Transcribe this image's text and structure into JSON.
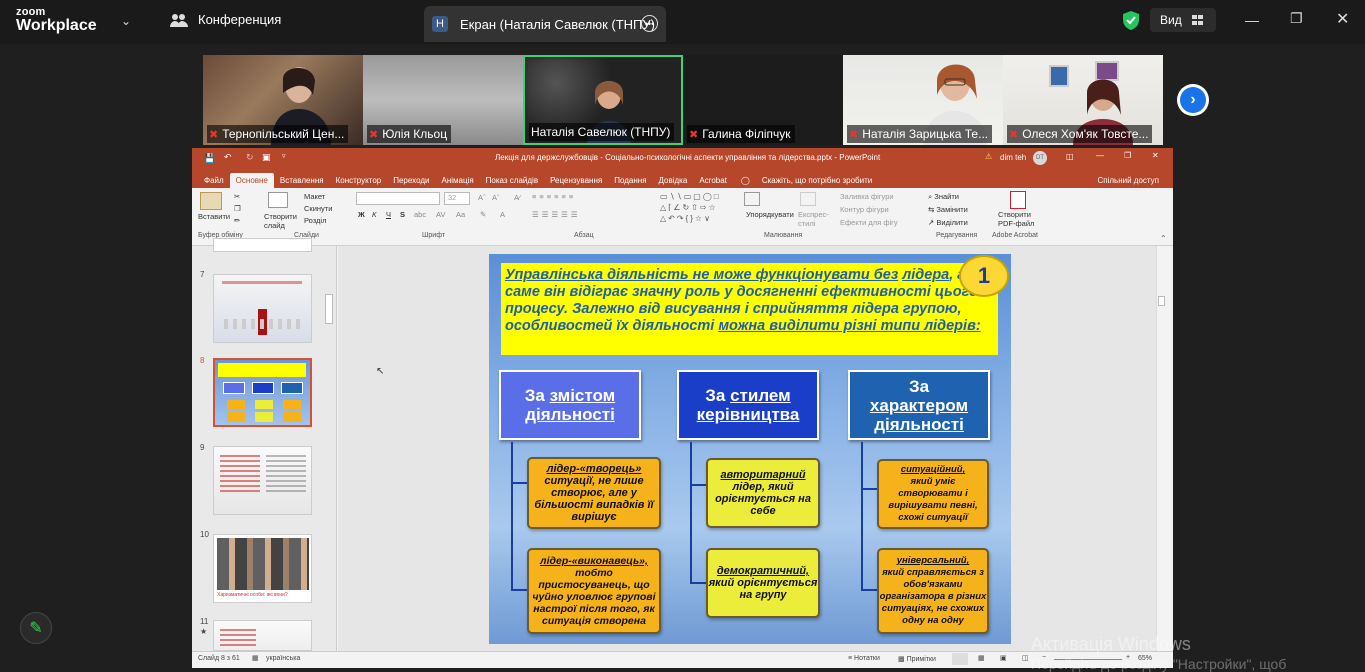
{
  "zoom": {
    "logo_top": "zoom",
    "logo_bottom": "Workplace",
    "conference_label": "Конференция",
    "share_tab_letter": "Н",
    "share_tab_label": "Екран (Наталія Савелюк (ТНПУ)",
    "view_label": "Вид",
    "participants": [
      {
        "name": "Тернопільський Цен...",
        "muted": true
      },
      {
        "name": "Юлія Кльоц",
        "muted": true
      },
      {
        "name": "Наталія Савелюк (ТНПУ)",
        "muted": false,
        "active_speaker": true
      },
      {
        "name": "Галина Філіпчук",
        "muted": true
      },
      {
        "name": "Наталія Зарицька Те...",
        "muted": true
      },
      {
        "name": "Олеся Хом'як Товсте...",
        "muted": true
      }
    ],
    "accent_color": "#1a73e8",
    "shield_color": "#22c55e"
  },
  "ppt": {
    "title": "Лекція для держслужбовців - Соціально-психологічні аспекти управління та лідерства.pptx - PowerPoint",
    "user": "dim teh",
    "user_initials": "DT",
    "warning": "⚠",
    "tabs": [
      "Файл",
      "Основне",
      "Вставлення",
      "Конструктор",
      "Переходи",
      "Анімація",
      "Показ слайдів",
      "Рецензування",
      "Подання",
      "Довідка",
      "Acrobat"
    ],
    "tell_me": "Скажіть, що потрібно зробити",
    "share": "Спільний доступ",
    "ribbon": {
      "paste": "Вставити",
      "clipboard": "Буфер обміну",
      "new_slide": "Створити слайд",
      "layout": "Макет",
      "reset": "Скинути",
      "section": "Розділ",
      "slides": "Слайди",
      "font": "Шрифт",
      "paragraph": "Абзац",
      "arrange": "Упорядкувати",
      "quick_styles": "Експрес-стилі",
      "shape_fill": "Заливка фігури",
      "shape_outline": "Контур фігури",
      "shape_effects": "Ефекти для фігу",
      "drawing": "Малювання",
      "find": "Знайти",
      "replace": "Замінити",
      "select": "Виділити",
      "editing": "Редагування",
      "create_pdf": "Створити PDF-файл",
      "adobe": "Adobe Acrobat",
      "font_size": "32",
      "bold": "Ж",
      "italic": "К",
      "underline": "Ч",
      "strike": "S"
    },
    "thumb_numbers": [
      "7",
      "8",
      "9",
      "10",
      "11"
    ],
    "thumb_caption_10": "Харизматичні особи: які вони?",
    "status": {
      "slide": "Слайд 8 з 61",
      "lang": "українська",
      "notes": "Нотатки",
      "comments": "Примітки",
      "zoom": "65%"
    },
    "brand_color": "#b7472a"
  },
  "slide": {
    "number": "1",
    "intro_u1": "Управлінська діяльність не може функціонувати без",
    "intro_u2": "лідера",
    "intro_rest": ", адже саме він відіграє значну роль у досягненні ефективності цього процесу. Залежно від висування і сприйняття лідера групою, особливостей їх діяльності",
    "intro_u3": "можна виділити різні типи лідерів:",
    "headers": [
      {
        "pre": "За ",
        "u": "змістом діяльності",
        "bg": "#5a6ee8"
      },
      {
        "pre": "За ",
        "u": "стилем керівництва",
        "bg": "#1a3ec8"
      },
      {
        "pre": "За ",
        "u": "характером діяльності",
        "bg": "#1f63b0"
      }
    ],
    "boxes": [
      {
        "u": "лідер-«творець»",
        "rest": "ситуації, не лише створює, але у більшості випадків її вирішує"
      },
      {
        "u": "лідер-«виконавець»,",
        "rest": "тобто пристосуванець, що чуйно уловлює групові настрої після того, як ситуація створена"
      },
      {
        "u": "авторитарний",
        "rest": "лідер, який орієнтується на себе"
      },
      {
        "u": "демократичний,",
        "rest": "який орієнтується на групу"
      },
      {
        "u": "ситуаційний,",
        "rest": "який уміє створювати і вирішувати певні, схожі ситуації"
      },
      {
        "u": "універсальний,",
        "rest": "який справляється з обов'язками організатора в різних ситуаціях, не схожих одну на одну"
      }
    ]
  },
  "os": {
    "activation_title": "Активація Windows",
    "activation_sub": "Перейдіть до розділу \"Настройки\", щоб"
  }
}
